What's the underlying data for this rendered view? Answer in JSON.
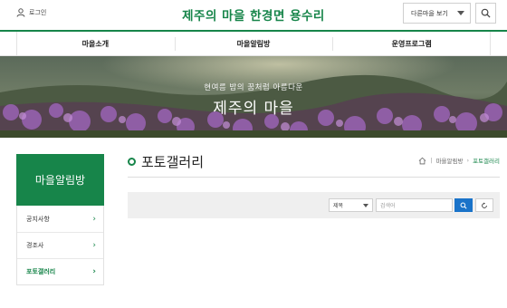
{
  "header": {
    "login_label": "로그인",
    "site_title": "제주의 마을 한경면 용수리",
    "other_village_label": "다른마을 보기"
  },
  "gnb": {
    "items": [
      {
        "label": "마을소개"
      },
      {
        "label": "마을알림방"
      },
      {
        "label": "운영프로그램"
      }
    ]
  },
  "banner": {
    "subtitle": "현여름 밤의 꿈처럼 아름다운",
    "title": "제주의 마을"
  },
  "sidebar": {
    "heading": "마을알림방",
    "items": [
      {
        "label": "공지사항",
        "active": false
      },
      {
        "label": "경조사",
        "active": false
      },
      {
        "label": "포토갤러리",
        "active": true
      }
    ]
  },
  "main": {
    "page_title": "포토갤러리",
    "breadcrumb": {
      "parent": "마을알림방",
      "current": "포토갤러리"
    },
    "search": {
      "field_select_value": "제목",
      "keyword_placeholder": "검색어"
    }
  },
  "colors": {
    "brand_green": "#17854a",
    "search_button_blue": "#1a73c9",
    "search_bar_bg": "#efefef"
  },
  "icons": {
    "login": "user-icon",
    "search": "search-icon",
    "home": "home-icon",
    "reset": "refresh-icon",
    "chevron": "chevron-right-icon",
    "dropdown": "chevron-down-icon"
  }
}
